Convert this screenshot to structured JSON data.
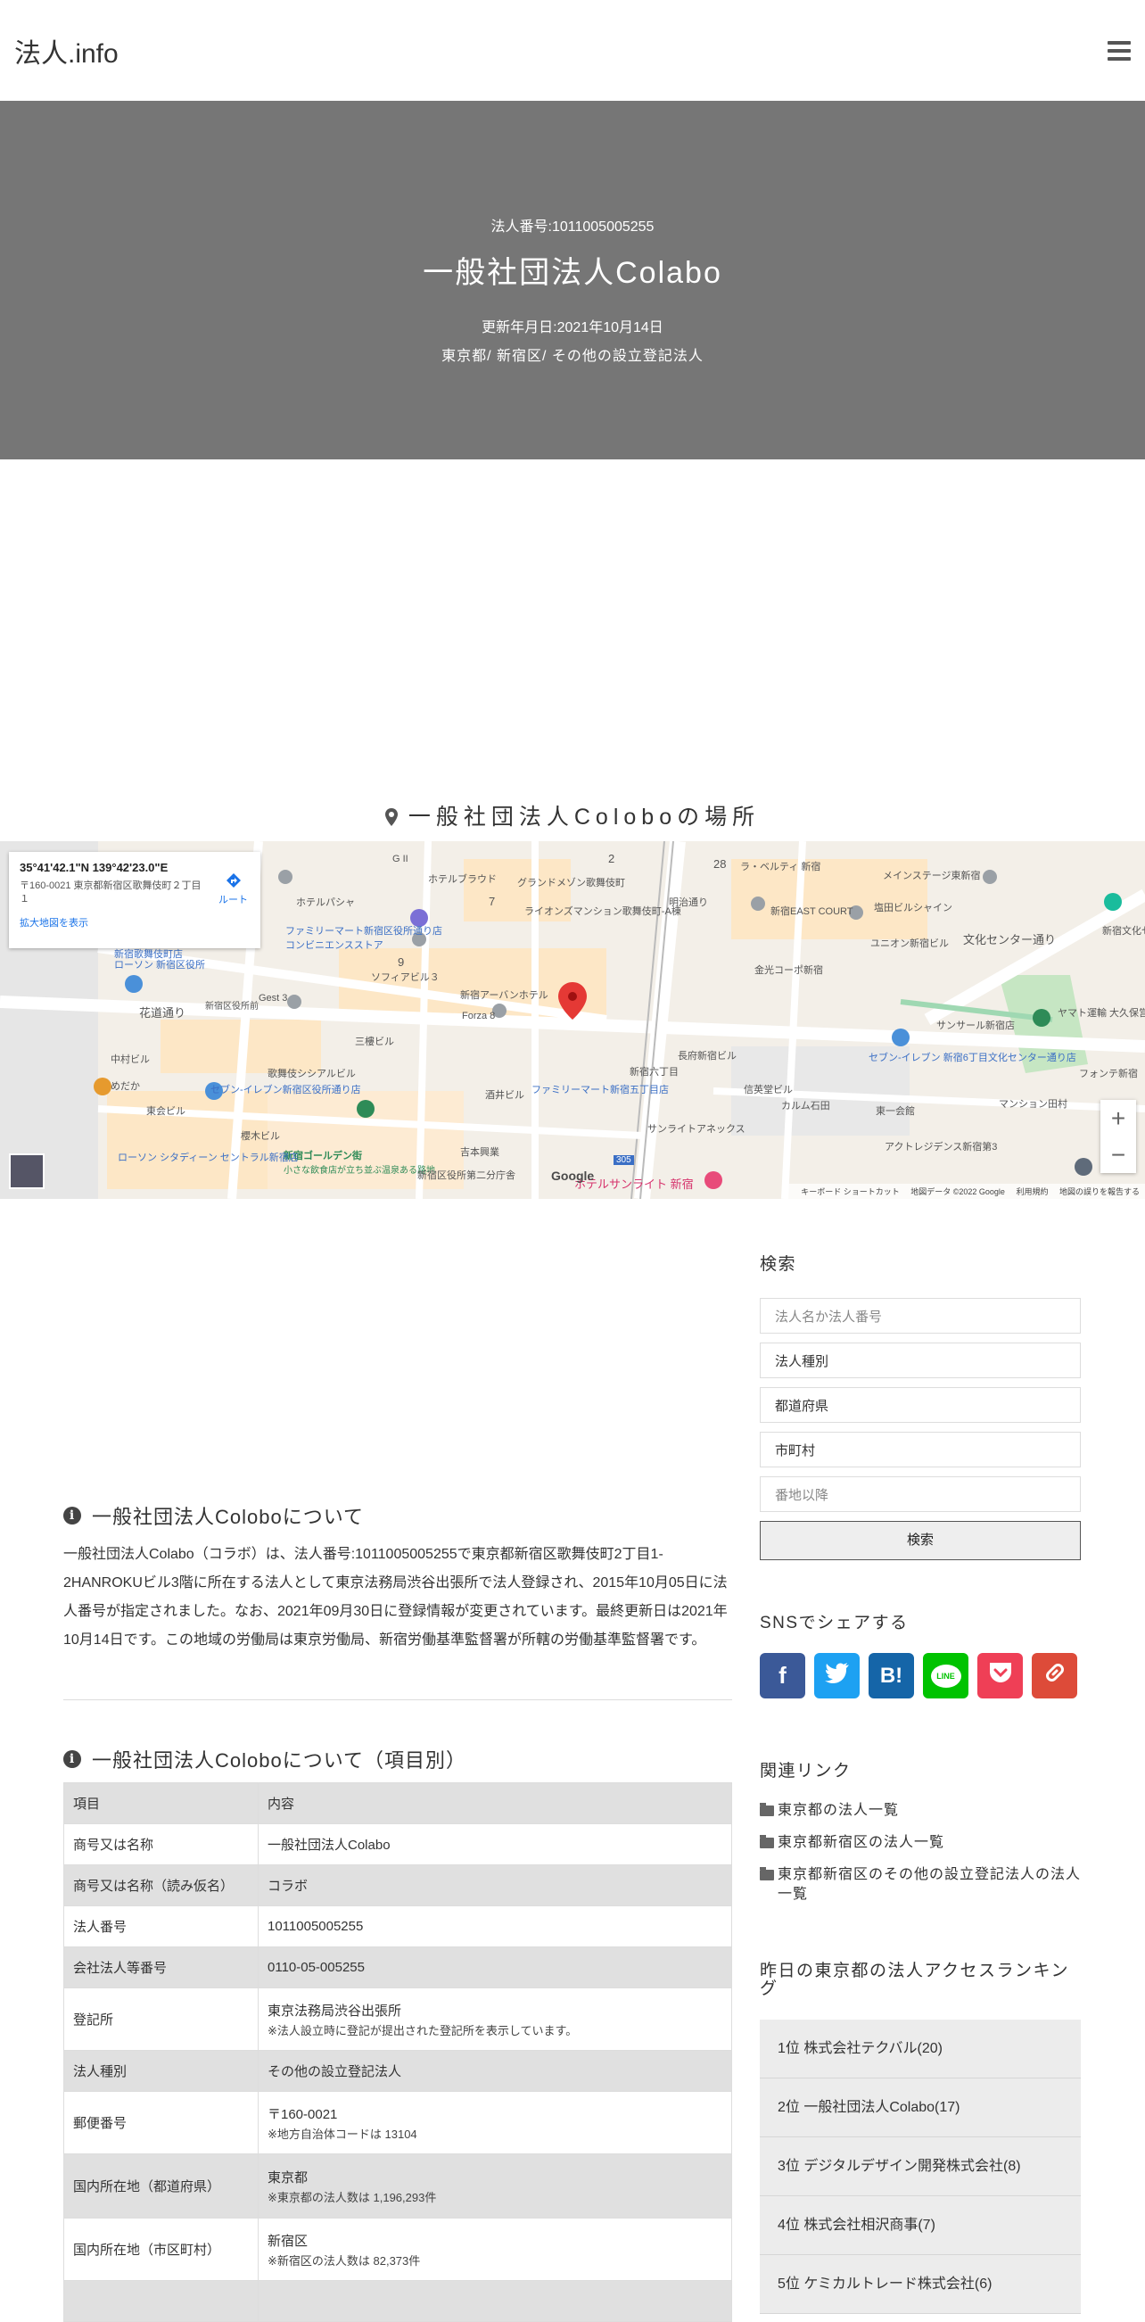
{
  "site": {
    "logo": "法人.info"
  },
  "hero": {
    "number": "法人番号:1011005005255",
    "title": "一般社団法人Colabo",
    "updated": "更新年月日:2021年10月14日",
    "breadcrumb": "東京都/ 新宿区/ その他の設立登記法人"
  },
  "map": {
    "title": "一般社団法人Coloboの場所",
    "info": {
      "coords": "35°41'42.1\"N 139°42'23.0\"E",
      "address": "〒160-0021 東京都新宿区歌舞伎町２丁目１",
      "larger_map": "拡大地図を表示",
      "route": "ルート"
    },
    "labels": [
      "ホテルブラウド",
      "グランドメゾン歌舞伎町",
      "ライオンズマンション歌舞伎町-A棟",
      "ファミリーマート新宿区役所通り店",
      "コンビニエンスストア",
      "新宿歌舞伎町店",
      "ソフィアビル３",
      "新宿アーバンホテル",
      "Forza 8",
      "三樓ビル",
      "歌舞伎シシアルビル",
      "セブン-イレブン新宿区役所通り店",
      "ファミリーマート新宿五丁目店",
      "新宿ゴールデン街",
      "小さな飲食店が立ち並ぶ温泉ある路地",
      "ローソン シタディーン セントラル新宿店",
      "新宿EAST COURT",
      "ユニオン新宿ビル",
      "塩田ビルシャイン",
      "メインステージ東新宿",
      "金光コーポ新宿",
      "サンサール新宿店",
      "セブン-イレブン 新宿6丁目文化センター通り店",
      "ヤマト運輸 大久保営業所(新宿5丁",
      "長府新宿ビル",
      "信英堂ビル",
      "カルム石田",
      "東一会館",
      "マンション田村",
      "サンライトアネックス",
      "アクトレジデンス新宿第3",
      "ホテルサンライト 新宿",
      "新宿文化セ",
      "花道通り",
      "文化センター通り",
      "明治通り",
      "ホテルパシャ",
      "フォンテ新宿",
      "酒井ビル",
      "吉本興業",
      "新宿区役所第二分庁舎",
      "新宿六丁目",
      "東会ビル",
      "めだか",
      "櫻木ビル",
      "中村ビル",
      "Gest 3",
      "新宿区役所前",
      "ローソン 新宿区役所",
      "G II",
      "ラ・ベルティ 新宿"
    ],
    "numbers": [
      "2",
      "7",
      "9",
      "28",
      "305"
    ],
    "google": "Google",
    "footer": [
      "キーボード ショートカット",
      "地図データ ©2022 Google",
      "利用規約",
      "地図の誤りを報告する"
    ],
    "zoom_in": "+",
    "zoom_out": "−"
  },
  "about": {
    "heading": "一般社団法人Coloboについて",
    "text": "一般社団法人Colabo（コラボ）は、法人番号:1011005005255で東京都新宿区歌舞伎町2丁目1-2HANROKUビル3階に所在する法人として東京法務局渋谷出張所で法人登録され、2015年10月05日に法人番号が指定されました。なお、2021年09月30日に登録情報が変更されています。最終更新日は2021年10月14日です。この地域の労働局は東京労働局、新宿労働基準監督署が所轄の労働基準監督署です。"
  },
  "detail": {
    "heading": "一般社団法人Coloboについて（項目別）",
    "rows": [
      {
        "k": "項目",
        "v": "内容",
        "note": ""
      },
      {
        "k": "商号又は名称",
        "v": "一般社団法人Colabo",
        "note": ""
      },
      {
        "k": "商号又は名称（読み仮名）",
        "v": "コラボ",
        "note": ""
      },
      {
        "k": "法人番号",
        "v": "1011005005255",
        "note": ""
      },
      {
        "k": "会社法人等番号",
        "v": "0110-05-005255",
        "note": ""
      },
      {
        "k": "登記所",
        "v": "東京法務局渋谷出張所",
        "note": "※法人設立時に登記が提出された登記所を表示しています。"
      },
      {
        "k": "法人種別",
        "v": "その他の設立登記法人",
        "note": ""
      },
      {
        "k": "郵便番号",
        "v": "〒160-0021",
        "note": "※地方自治体コードは 13104"
      },
      {
        "k": "国内所在地（都道府県）",
        "v": "東京都",
        "note": "※東京都の法人数は 1,196,293件"
      },
      {
        "k": "国内所在地（市区町村）",
        "v": "新宿区",
        "note": "※新宿区の法人数は 82,373件"
      }
    ]
  },
  "search": {
    "heading": "検索",
    "name_placeholder": "法人名か法人番号",
    "type_select": "法人種別",
    "pref_select": "都道府県",
    "city_select": "市町村",
    "address_placeholder": "番地以降",
    "button": "検索"
  },
  "share": {
    "heading": "SNSでシェアする",
    "buttons": [
      {
        "name": "facebook-icon",
        "glyph": "f",
        "color": "#3b5998"
      },
      {
        "name": "twitter-icon",
        "glyph": "t",
        "color": "#1da1f2"
      },
      {
        "name": "hatena-icon",
        "glyph": "B!",
        "color": "#00a4de"
      },
      {
        "name": "line-icon",
        "glyph": "LINE",
        "color": "#00c300"
      },
      {
        "name": "pocket-icon",
        "glyph": "P",
        "color": "#ef3f56"
      },
      {
        "name": "link-icon",
        "glyph": "∞",
        "color": "#dd4b39"
      }
    ]
  },
  "related": {
    "heading": "関連リンク",
    "links": [
      "東京都の法人一覧",
      "東京都新宿区の法人一覧",
      "東京都新宿区のその他の設立登記法人の法人一覧"
    ]
  },
  "ranking": {
    "heading": "昨日の東京都の法人アクセスランキング",
    "items": [
      "1位 株式会社テクバル(20)",
      "2位 一般社団法人Colabo(17)",
      "3位 デジタルデザイン開発株式会社(8)",
      "4位 株式会社相沢商事(7)",
      "5位 ケミカルトレード株式会社(6)"
    ]
  }
}
